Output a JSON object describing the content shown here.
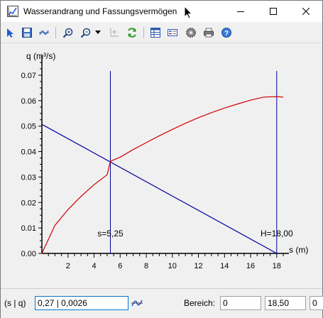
{
  "window": {
    "title": "Wasserandrang und Fassungsvermögen"
  },
  "toolbar": {
    "items": [
      "pointer-icon",
      "save-icon",
      "curve-icon",
      "zoom-icon",
      "zoom-options-icon",
      "dropdown-arrow-icon",
      "move-axes-icon",
      "refresh-icon",
      "table-icon",
      "legend-icon",
      "settings-icon",
      "print-icon",
      "help-icon"
    ]
  },
  "chart_data": {
    "type": "line",
    "ylabel": "q (m³/s)",
    "xlabel": "s (m)",
    "xlim": [
      0,
      18.5
    ],
    "ylim": [
      0,
      0.075
    ],
    "xticks": [
      "2",
      "4",
      "6",
      "8",
      "10",
      "12",
      "14",
      "16",
      "18"
    ],
    "yticks": [
      "0.00",
      "0.01",
      "0.02",
      "0.03",
      "0.04",
      "0.05",
      "0.06",
      "0.07"
    ],
    "series": [
      {
        "color": "#0000a0",
        "x": [
          0,
          18
        ],
        "y": [
          0.0507,
          0
        ]
      },
      {
        "color": "#d00000",
        "x": [
          0,
          1,
          2,
          3,
          4,
          5,
          5.25,
          6,
          7,
          8,
          9,
          10,
          11,
          12,
          13,
          14,
          15,
          16,
          17,
          18,
          18.5
        ],
        "y": [
          0,
          0.011,
          0.0172,
          0.0224,
          0.027,
          0.0309,
          0.0362,
          0.0378,
          0.0408,
          0.0435,
          0.0462,
          0.0487,
          0.0511,
          0.0533,
          0.0553,
          0.0571,
          0.0587,
          0.0602,
          0.0614,
          0.0616,
          0.0614
        ]
      }
    ],
    "markers": [
      {
        "x": 5.25,
        "label": "s=5,25"
      },
      {
        "x": 18.0,
        "label": "H=18,00"
      }
    ]
  },
  "status": {
    "coord_label": "(s | q)",
    "coord_value": "0,27 | 0,0026",
    "range_label": "Bereich:",
    "range_from": "0",
    "range_to": "18,50",
    "range_extra": "0"
  },
  "colors": {
    "accent": "#0078d7",
    "line_blue": "#0000a0",
    "line_red": "#d00000"
  }
}
